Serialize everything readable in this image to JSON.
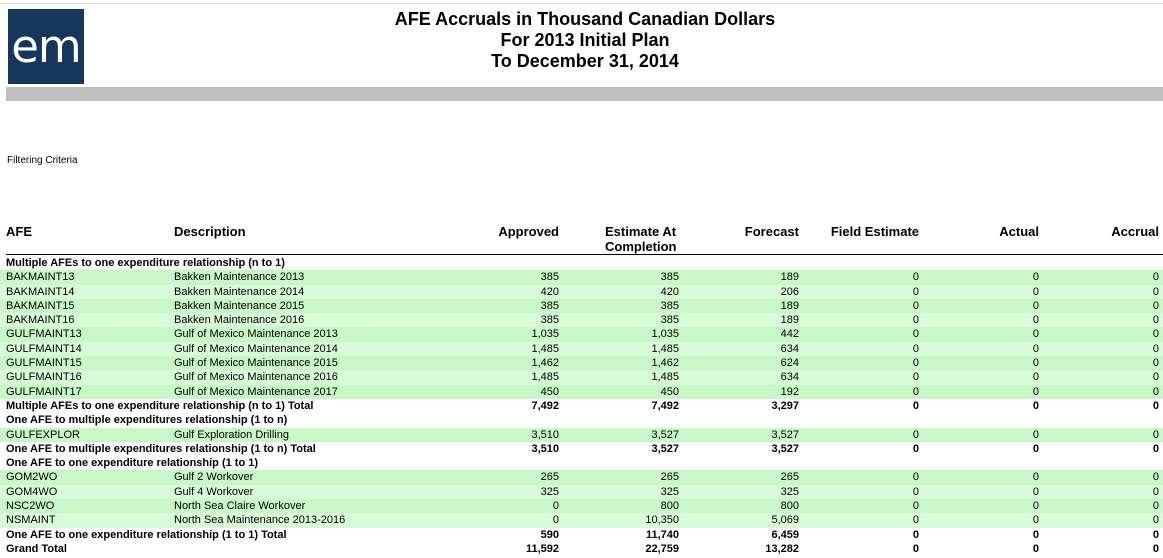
{
  "report": {
    "logo_text": "em",
    "title1": "AFE Accruals in Thousand Canadian Dollars",
    "title2": "For 2013 Initial Plan",
    "title3": "To December 31, 2014",
    "filtering_label": "Filtering Criteria"
  },
  "columns": {
    "afe": "AFE",
    "description": "Description",
    "approved": "Approved",
    "eac_line1": "Estimate At",
    "eac_line2": "Completion",
    "forecast": "Forecast",
    "field_estimate": "Field Estimate",
    "actual": "Actual",
    "accrual": "Accrual"
  },
  "rows": [
    {
      "kind": "group",
      "label": "Multiple AFEs to one expenditure relationship (n to 1)"
    },
    {
      "kind": "item",
      "afe": "BAKMAINT13",
      "desc": "Bakken Maintenance 2013",
      "approved": "385",
      "eac": "385",
      "forecast": "189",
      "field": "0",
      "actual": "0",
      "accrual": "0"
    },
    {
      "kind": "item",
      "afe": "BAKMAINT14",
      "desc": "Bakken Maintenance 2014",
      "approved": "420",
      "eac": "420",
      "forecast": "206",
      "field": "0",
      "actual": "0",
      "accrual": "0"
    },
    {
      "kind": "item",
      "afe": "BAKMAINT15",
      "desc": "Bakken Maintenance 2015",
      "approved": "385",
      "eac": "385",
      "forecast": "189",
      "field": "0",
      "actual": "0",
      "accrual": "0"
    },
    {
      "kind": "item",
      "afe": "BAKMAINT16",
      "desc": "Bakken Maintenance 2016",
      "approved": "385",
      "eac": "385",
      "forecast": "189",
      "field": "0",
      "actual": "0",
      "accrual": "0"
    },
    {
      "kind": "item",
      "afe": "GULFMAINT13",
      "desc": "Gulf of Mexico Maintenance 2013",
      "approved": "1,035",
      "eac": "1,035",
      "forecast": "442",
      "field": "0",
      "actual": "0",
      "accrual": "0"
    },
    {
      "kind": "item",
      "afe": "GULFMAINT14",
      "desc": "Gulf of Mexico Maintenance 2014",
      "approved": "1,485",
      "eac": "1,485",
      "forecast": "634",
      "field": "0",
      "actual": "0",
      "accrual": "0"
    },
    {
      "kind": "item",
      "afe": "GULFMAINT15",
      "desc": "Gulf of Mexico Maintenance 2015",
      "approved": "1,462",
      "eac": "1,462",
      "forecast": "624",
      "field": "0",
      "actual": "0",
      "accrual": "0"
    },
    {
      "kind": "item",
      "afe": "GULFMAINT16",
      "desc": "Gulf of Mexico Maintenance 2016",
      "approved": "1,485",
      "eac": "1,485",
      "forecast": "634",
      "field": "0",
      "actual": "0",
      "accrual": "0"
    },
    {
      "kind": "item",
      "afe": "GULFMAINT17",
      "desc": "Gulf of Mexico Maintenance 2017",
      "approved": "450",
      "eac": "450",
      "forecast": "192",
      "field": "0",
      "actual": "0",
      "accrual": "0"
    },
    {
      "kind": "total",
      "label": "Multiple AFEs to one expenditure relationship (n to 1) Total",
      "approved": "7,492",
      "eac": "7,492",
      "forecast": "3,297",
      "field": "0",
      "actual": "0",
      "accrual": "0"
    },
    {
      "kind": "group",
      "label": "One AFE to multiple expenditures relationship (1 to n)"
    },
    {
      "kind": "item",
      "afe": "GULFEXPLOR",
      "desc": "Gulf Exploration Drilling",
      "approved": "3,510",
      "eac": "3,527",
      "forecast": "3,527",
      "field": "0",
      "actual": "0",
      "accrual": "0"
    },
    {
      "kind": "total",
      "label": "One AFE to multiple expenditures relationship (1 to n) Total",
      "approved": "3,510",
      "eac": "3,527",
      "forecast": "3,527",
      "field": "0",
      "actual": "0",
      "accrual": "0"
    },
    {
      "kind": "group",
      "label": "One AFE to one expenditure relationship (1 to 1)"
    },
    {
      "kind": "item",
      "afe": "GOM2WO",
      "desc": "Gulf 2 Workover",
      "approved": "265",
      "eac": "265",
      "forecast": "265",
      "field": "0",
      "actual": "0",
      "accrual": "0"
    },
    {
      "kind": "item",
      "afe": "GOM4WO",
      "desc": "Gulf 4 Workover",
      "approved": "325",
      "eac": "325",
      "forecast": "325",
      "field": "0",
      "actual": "0",
      "accrual": "0"
    },
    {
      "kind": "item",
      "afe": "NSC2WO",
      "desc": "North Sea Claire Workover",
      "approved": "0",
      "eac": "800",
      "forecast": "800",
      "field": "0",
      "actual": "0",
      "accrual": "0"
    },
    {
      "kind": "item",
      "afe": "NSMAINT",
      "desc": "North Sea Maintenance 2013-2016",
      "approved": "0",
      "eac": "10,350",
      "forecast": "5,069",
      "field": "0",
      "actual": "0",
      "accrual": "0"
    },
    {
      "kind": "total",
      "label": "One AFE to one expenditure relationship (1 to 1) Total",
      "approved": "590",
      "eac": "11,740",
      "forecast": "6,459",
      "field": "0",
      "actual": "0",
      "accrual": "0"
    },
    {
      "kind": "total",
      "label": "Grand Total",
      "approved": "11,592",
      "eac": "22,759",
      "forecast": "13,282",
      "field": "0",
      "actual": "0",
      "accrual": "0"
    }
  ]
}
